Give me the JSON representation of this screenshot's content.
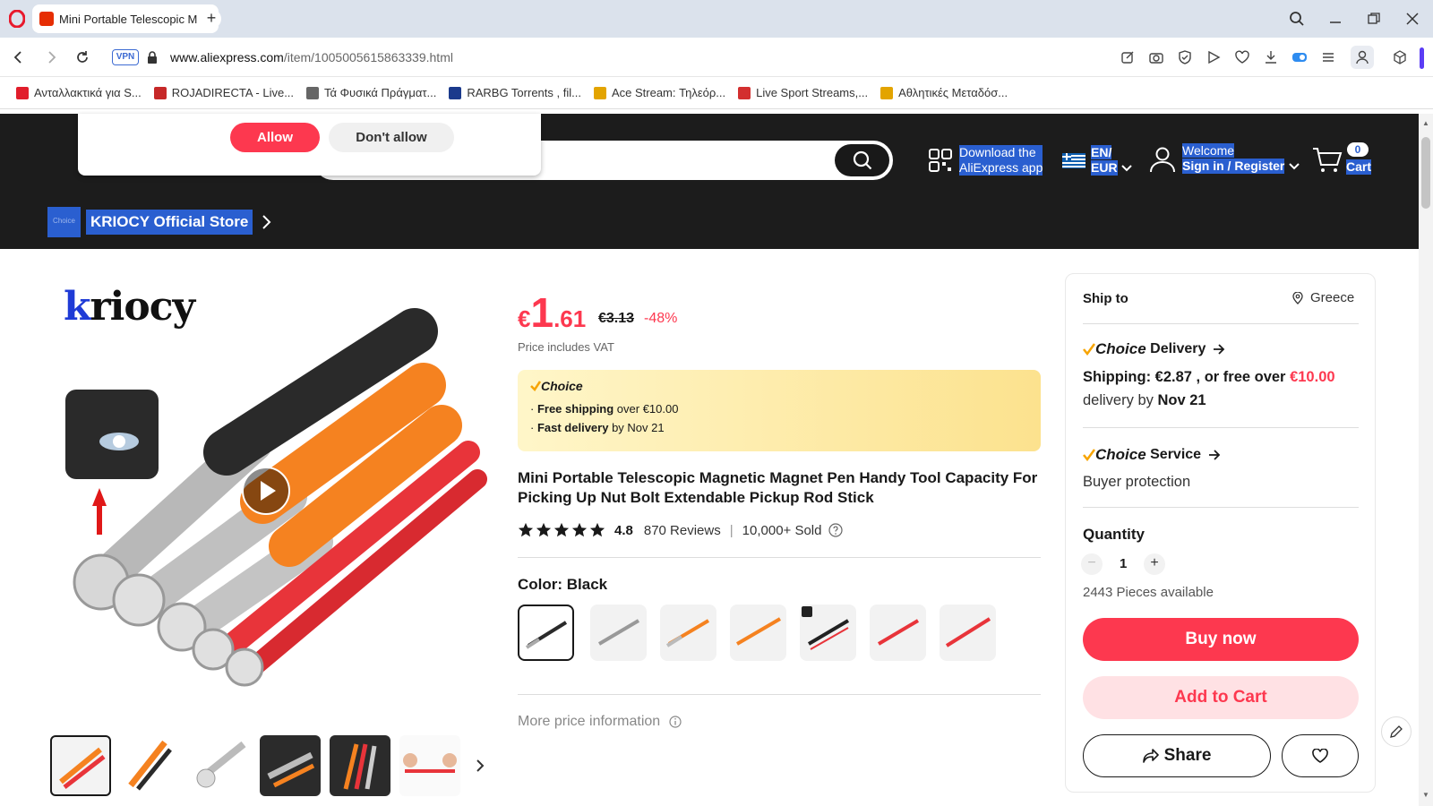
{
  "browser": {
    "tab_title": "Mini Portable Telescopic M",
    "new_tab_label": "+",
    "url_host": "www.aliexpress.com",
    "url_path": "/item/1005005615863339.html",
    "vpn_label": "VPN"
  },
  "bookmarks": [
    {
      "label": "Ανταλλακτικά για S...",
      "color": "#e11d2b"
    },
    {
      "label": "ROJADIRECTA - Live...",
      "color": "#c62828"
    },
    {
      "label": "Τά Φυσικά Πράγματ...",
      "color": "#444444"
    },
    {
      "label": "RARBG Torrents , fil...",
      "color": "#1b3a8c"
    },
    {
      "label": "Ace Stream: Τηλεόρ...",
      "color": "#e3a400"
    },
    {
      "label": "Live Sport Streams,...",
      "color": "#d32f2f"
    },
    {
      "label": "Αθλητικές Μεταδόσ...",
      "color": "#e3a400"
    }
  ],
  "permission": {
    "allow": "Allow",
    "deny": "Don't allow"
  },
  "header": {
    "download_line1": "Download the",
    "download_line2": "AliExpress app",
    "lang_line1": "EN/",
    "lang_line2": "EUR",
    "welcome": "Welcome",
    "signin": "Sign in / Register",
    "cart_label": "Cart",
    "cart_count": "0",
    "store_badge": "Choice",
    "store_name": "KRIOCY Official Store",
    "brand_logo": "kriocy"
  },
  "product": {
    "currency": "€",
    "price_int": "1",
    "price_dec": ".61",
    "old_price": "€3.13",
    "discount": "-48%",
    "vat_note": "Price includes VAT",
    "choice_title": "Choice",
    "choice_line1_bold": "Free shipping",
    "choice_line1_rest": " over €10.00",
    "choice_line2_bold": "Fast delivery",
    "choice_line2_rest": " by Nov 21",
    "title": "Mini Portable Telescopic Magnetic Magnet Pen Handy Tool Capacity For Picking Up Nut Bolt Extendable Pickup Rod Stick",
    "rating": "4.8",
    "stars": 5,
    "reviews": "870 Reviews",
    "sold": "10,000+ Sold",
    "color_label": "Color: Black",
    "more_price": "More price information"
  },
  "shipping": {
    "ship_to_label": "Ship to",
    "country": "Greece",
    "choice_word": "Choice",
    "delivery_word": " Delivery",
    "shipping_text": "Shipping: €2.87 , or free over ",
    "shipping_threshold": "€10.00",
    "delivery_prefix": "delivery by ",
    "delivery_date": "Nov 21",
    "service_word": " Service",
    "buyer_protection": "Buyer protection",
    "quantity_label": "Quantity",
    "quantity": "1",
    "available": "2443 Pieces available",
    "buy_now": "Buy now",
    "add_to_cart": "Add to Cart",
    "share": "Share"
  },
  "colors": {
    "accent": "#fd384f",
    "header_bg": "#1c1c1c",
    "selection": "#2a5fd0"
  }
}
